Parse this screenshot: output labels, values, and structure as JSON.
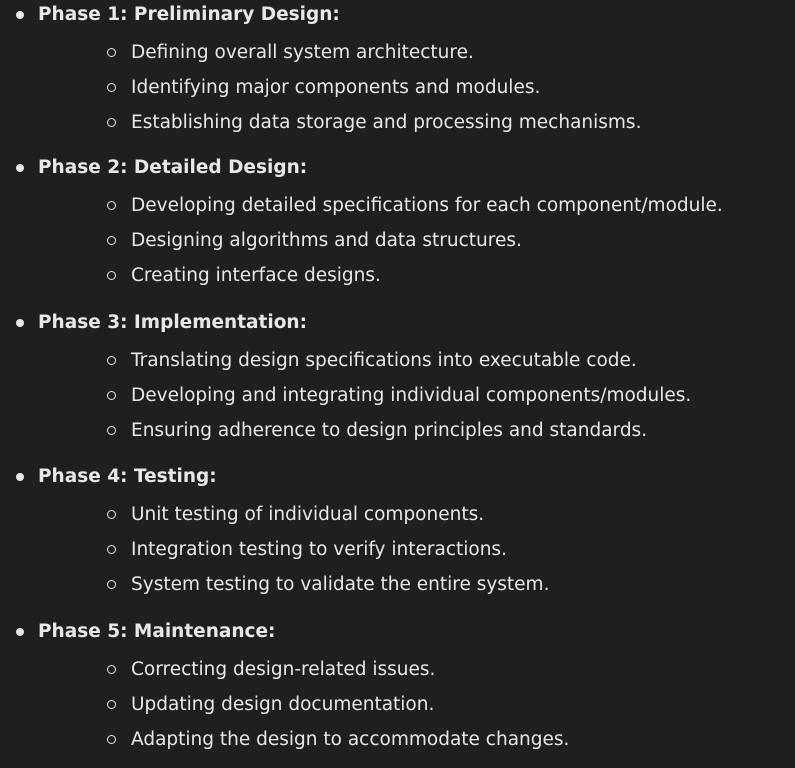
{
  "phases": [
    {
      "title": "Phase 1: Preliminary Design:",
      "items": [
        "Defining overall system architecture.",
        "Identifying major components and modules.",
        "Establishing data storage and processing mechanisms."
      ]
    },
    {
      "title": "Phase 2: Detailed Design:",
      "items": [
        "Developing detailed specifications for each component/module.",
        "Designing algorithms and data structures.",
        "Creating interface designs."
      ]
    },
    {
      "title": "Phase 3: Implementation:",
      "items": [
        "Translating design specifications into executable code.",
        "Developing and integrating individual components/modules.",
        "Ensuring adherence to design principles and standards."
      ]
    },
    {
      "title": "Phase 4: Testing:",
      "items": [
        "Unit testing of individual components.",
        "Integration testing to verify interactions.",
        "System testing to validate the entire system."
      ]
    },
    {
      "title": "Phase 5: Maintenance:",
      "items": [
        "Correcting design-related issues.",
        "Updating design documentation.",
        "Adapting the design to accommodate changes."
      ]
    }
  ]
}
